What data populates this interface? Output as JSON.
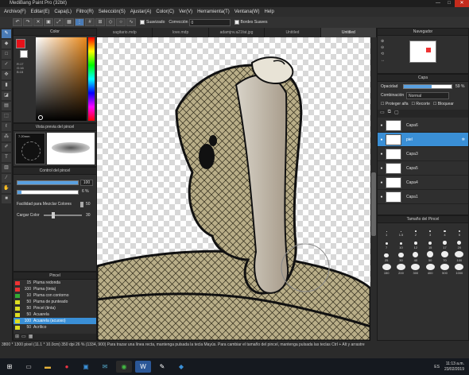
{
  "window": {
    "title": "MediBang Paint Pro (32bit)",
    "controls": [
      "—",
      "□",
      "✕"
    ]
  },
  "menu": [
    "Archivo(F)",
    "Editar(E)",
    "Capa(L)",
    "Filtro(R)",
    "Selección(S)",
    "Ajustar(A)",
    "Color(C)",
    "Ver(V)",
    "Herramienta(T)",
    "Ventana(W)",
    "Help"
  ],
  "toolbar": {
    "suavizado": "Suavizado",
    "correccion": "Corrección",
    "correccion_value": "0",
    "bordes": "Bordes Suaves"
  },
  "tabs": [
    "sagitario.mdp",
    "love.mdp",
    "adamjnv.a21fat.jpg",
    "Untitled",
    "Untitled"
  ],
  "color_panel": {
    "title": "Color",
    "values": [
      "R:17",
      "G:16",
      "B:15"
    ],
    "primary": "#e6121a",
    "secondary": "#ffffff"
  },
  "brush_preview": {
    "title": "Vista previa del pincel",
    "size": "7.20mm"
  },
  "brush_control": {
    "title": "Control del pincel",
    "size_value": "100",
    "opacity_value": "6 %",
    "mix_label": "Facilidad para Mezclar Colores",
    "mix_value": "50",
    "load_label": "Cargar Color",
    "load_value": "30"
  },
  "brush_list": {
    "title": "Pincel",
    "items": [
      {
        "n": "15",
        "name": "Pluma redonda",
        "color": "#e33"
      },
      {
        "n": "100",
        "name": "Pluma (tinta)",
        "color": "#e33"
      },
      {
        "n": "10",
        "name": "Pluma con contorno",
        "color": "#3a3"
      },
      {
        "n": "50",
        "name": "Pluma de punteado",
        "color": "#dd2"
      },
      {
        "n": "50",
        "name": "Pincel (tinta)",
        "color": "#dd2"
      },
      {
        "n": "50",
        "name": "Acuarela",
        "color": "#dd2"
      },
      {
        "n": "100",
        "name": "Acuarela (acuoso)",
        "color": "#dd2",
        "active": true
      },
      {
        "n": "50",
        "name": "Acrílico",
        "color": "#dd2"
      }
    ]
  },
  "navigator": {
    "title": "Navegador"
  },
  "layers": {
    "title": "Capa",
    "opacity_label": "Opacidad",
    "opacity": "59 %",
    "blend_label": "Combinación",
    "blend": "Normal",
    "protect": "Proteger alfa",
    "clip": "Recorte",
    "lock": "Bloquear",
    "items": [
      {
        "name": "Capa6"
      },
      {
        "name": "piel",
        "active": true
      },
      {
        "name": "Capa3"
      },
      {
        "name": "Capa5"
      },
      {
        "name": "Capa4"
      },
      {
        "name": "Capa1"
      }
    ]
  },
  "brush_size": {
    "title": "Tamaño del Pincel",
    "sizes": [
      "1",
      "1.5",
      "2",
      "3",
      "4",
      "5",
      "7",
      "10",
      "12",
      "15",
      "17",
      "20",
      "25",
      "30",
      "40",
      "50",
      "70",
      "100",
      "150",
      "200",
      "300",
      "400",
      "500",
      "1000"
    ]
  },
  "status": {
    "line1": "3800 * 1300 pixel   (11.1 * 10.0cm)   350 dpi   26 %   (1334, 900)   Para trazar una línea recta, mantenga pulsada la tecla Mayús. Para cambiar el tamaño del pincel, mantenga pulsada las teclas Ctrl + Alt y arrastre"
  },
  "taskbar": {
    "lang": "ES",
    "time": "11:13 a.m.",
    "date": "23/02/2019"
  }
}
